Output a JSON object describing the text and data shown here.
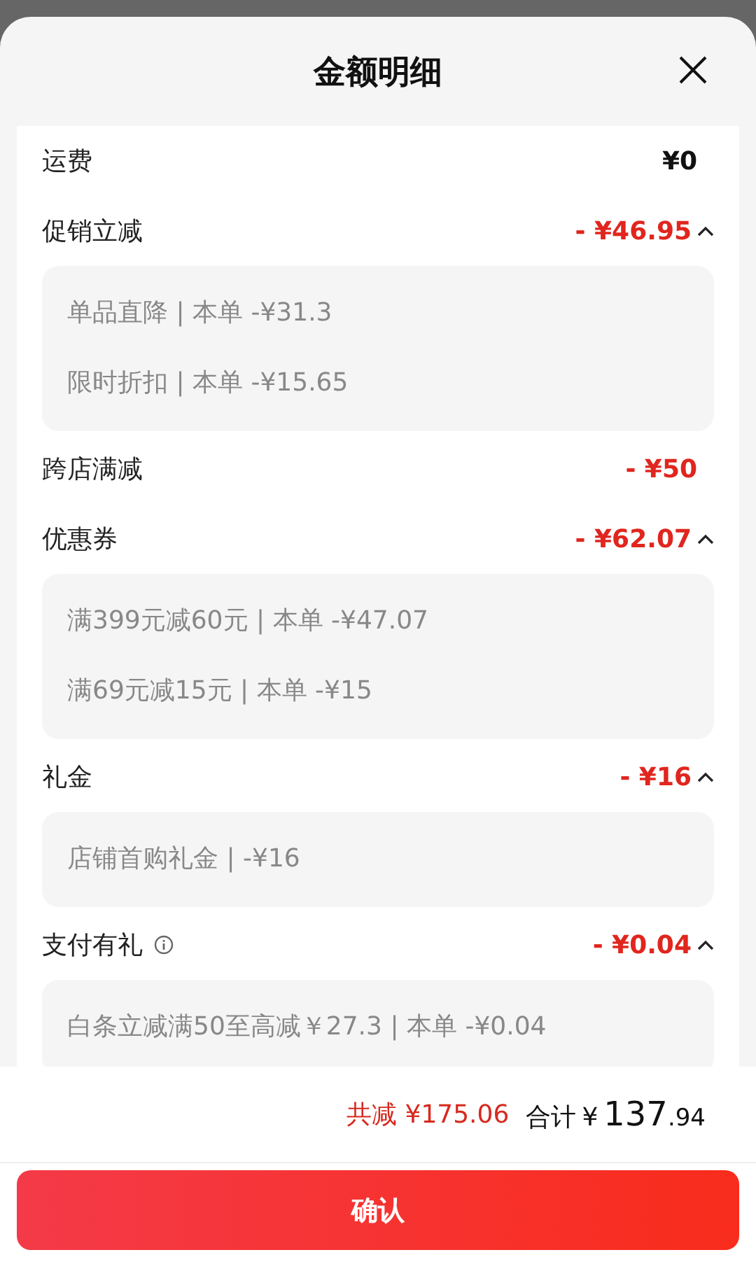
{
  "sheet": {
    "title": "金额明细"
  },
  "rows": [
    {
      "kind": "plain",
      "label": "运费",
      "amount": "¥0",
      "discount": false
    },
    {
      "kind": "group",
      "label": "促销立减",
      "amount": "- ¥46.95",
      "discount": true,
      "expanded": true,
      "details": [
        "单品直降 | 本单 -¥31.3",
        "限时折扣 | 本单 -¥15.65"
      ]
    },
    {
      "kind": "plain",
      "label": "跨店满减",
      "amount": "- ¥50",
      "discount": true
    },
    {
      "kind": "group",
      "label": "优惠券",
      "amount": "- ¥62.07",
      "discount": true,
      "expanded": true,
      "details": [
        "满399元减60元 | 本单 -¥47.07",
        "满69元减15元 | 本单 -¥15"
      ]
    },
    {
      "kind": "group",
      "label": "礼金",
      "amount": "- ¥16",
      "discount": true,
      "expanded": true,
      "details": [
        "店铺首购礼金 | -¥16"
      ]
    },
    {
      "kind": "group",
      "label": "支付有礼",
      "info": true,
      "amount": "- ¥0.04",
      "discount": true,
      "expanded": true,
      "details": [
        "白条立减满50至高减￥27.3 | 本单 -¥0.04"
      ]
    }
  ],
  "summary": {
    "saved": "共减 ¥175.06",
    "total_label": "合计",
    "currency": "¥",
    "integer": "137",
    "decimal": ".94"
  },
  "confirm_button": "确认"
}
